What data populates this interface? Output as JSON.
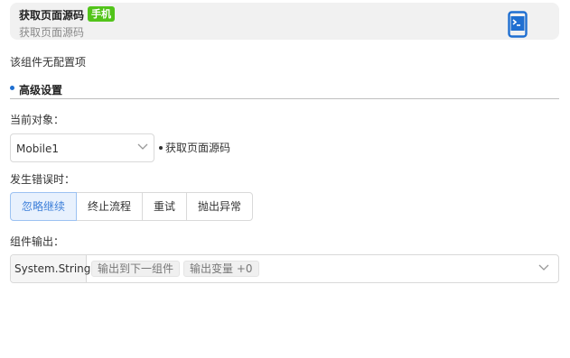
{
  "header": {
    "title": "获取页面源码",
    "badge": "手机",
    "subtitle": "获取页面源码",
    "icon": "mobile-terminal-icon",
    "accent": "#1f6fd1",
    "badge_color": "#52c41a"
  },
  "no_config_text": "该组件无配置项",
  "advanced": {
    "title": "高级设置"
  },
  "target": {
    "label": "当前对象：",
    "value": "Mobile1",
    "hint": "获取页面源码"
  },
  "on_error": {
    "label": "发生错误时：",
    "options": [
      "忽略继续",
      "终止流程",
      "重试",
      "抛出异常"
    ],
    "selected": "忽略继续"
  },
  "output": {
    "label": "组件输出：",
    "type": "System.String",
    "tags": [
      "输出到下一组件",
      "输出变量 +0"
    ]
  }
}
